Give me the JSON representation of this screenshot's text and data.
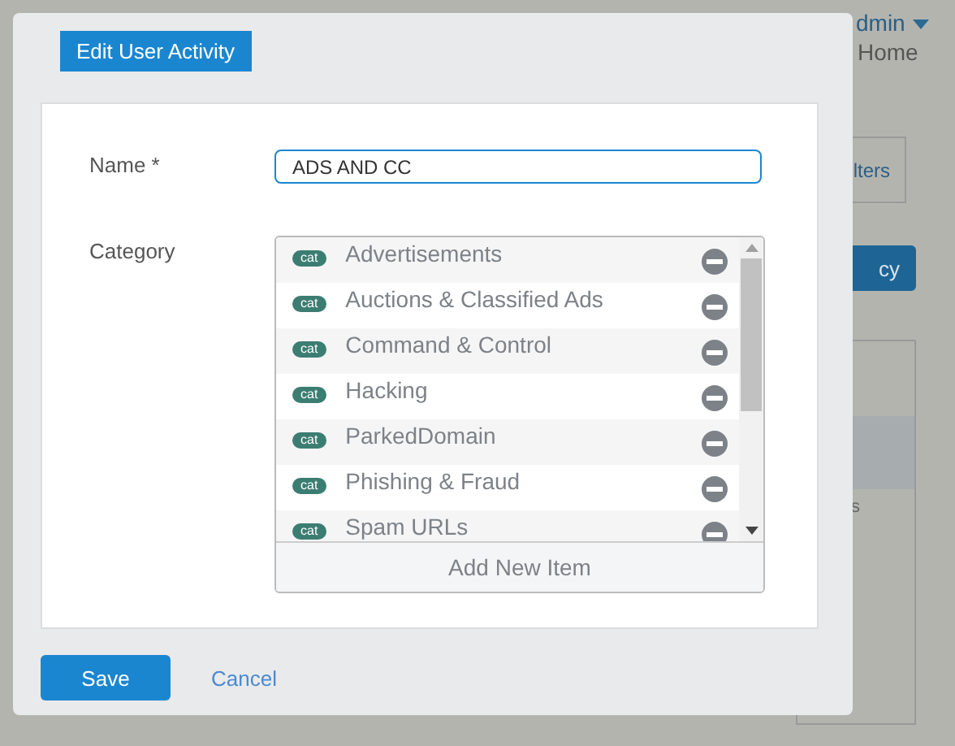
{
  "background": {
    "user_menu": "dmin",
    "home_link": "Home",
    "filters_button": "lters",
    "policy_button": "cy",
    "table_fragment": "s"
  },
  "dialog": {
    "title": "Edit User Activity",
    "name_field": {
      "label": "Name *",
      "value": "ADS AND CC"
    },
    "category": {
      "label": "Category",
      "items": [
        {
          "tag": "cat",
          "name": "Advertisements"
        },
        {
          "tag": "cat",
          "name": "Auctions & Classified Ads"
        },
        {
          "tag": "cat",
          "name": "Command & Control"
        },
        {
          "tag": "cat",
          "name": "Hacking"
        },
        {
          "tag": "cat",
          "name": "ParkedDomain"
        },
        {
          "tag": "cat",
          "name": "Phishing & Fraud"
        },
        {
          "tag": "cat",
          "name": "Spam URLs"
        }
      ],
      "add_item": "Add New Item"
    },
    "buttons": {
      "save": "Save",
      "cancel": "Cancel"
    }
  }
}
